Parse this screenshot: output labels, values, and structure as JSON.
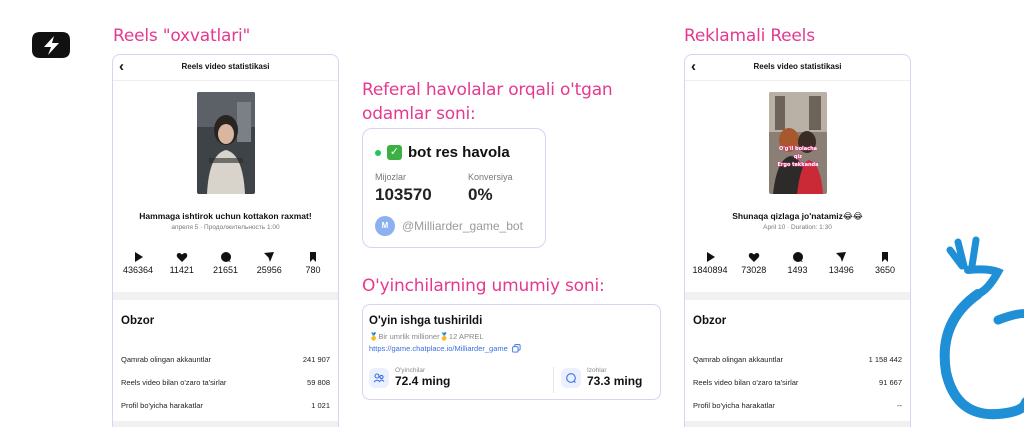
{
  "headings": {
    "left": "Reels \"oxvatlari\"",
    "right": "Reklamali Reels",
    "referral": "Referal havolalar orqali o'tgan odamlar soni:",
    "players": "O'yinchilarning umumiy soni:"
  },
  "phone_left": {
    "back_icon": "chevron-left-icon",
    "title": "Reels video statistikasi",
    "thumb_text": "",
    "caption": "Hammaga ishtirok uchun kottakon raxmat!",
    "meta": "апреля 5 · Продолжительность 1:00",
    "stats": [
      {
        "icon": "play-icon",
        "value": "436364"
      },
      {
        "icon": "heart-icon",
        "value": "11421"
      },
      {
        "icon": "comment-icon",
        "value": "21651"
      },
      {
        "icon": "share-icon",
        "value": "25956"
      },
      {
        "icon": "bookmark-icon",
        "value": "780"
      }
    ],
    "overview_title": "Obzor",
    "rows": [
      {
        "label": "Qamrab olingan akkauntlar",
        "value": "241 907"
      },
      {
        "label": "Reels video bilan o'zaro ta'sirlar",
        "value": "59 808"
      },
      {
        "label": "Profil bo'yicha harakatlar",
        "value": "1 021"
      }
    ]
  },
  "phone_right": {
    "back_icon": "chevron-left-icon",
    "title": "Reels video statistikasi",
    "thumb_text": "O'g'il bolacha qiz Ergo tekkanda",
    "caption": "Shunaqa qizlaga jo'natamiz😂😂",
    "meta": "April 10 · Duration: 1:30",
    "stats": [
      {
        "icon": "play-icon",
        "value": "1840894"
      },
      {
        "icon": "heart-icon",
        "value": "73028"
      },
      {
        "icon": "comment-icon",
        "value": "1493"
      },
      {
        "icon": "share-icon",
        "value": "13496"
      },
      {
        "icon": "bookmark-icon",
        "value": "3650"
      }
    ],
    "overview_title": "Obzor",
    "rows": [
      {
        "label": "Qamrab olingan akkauntlar",
        "value": "1 158 442"
      },
      {
        "label": "Reels video bilan o'zaro ta'sirlar",
        "value": "91 667"
      },
      {
        "label": "Profil bo'yicha harakatlar",
        "value": "--"
      }
    ]
  },
  "referral_card": {
    "check_icon": "check-box-icon",
    "title": "bot res havola",
    "clients_label": "Mijozlar",
    "clients_value": "103570",
    "conversion_label": "Konversiya",
    "conversion_value": "0%",
    "avatar_letter": "M",
    "bot_name": "@Milliarder_game_bot"
  },
  "game_card": {
    "title": "O'yin ishga tushirildi",
    "subtitle": "🥇Bir umrlik millioner🥇12 APREL",
    "link": "https://game.chatplace.io/Milliarder_game",
    "players_label": "O'yinchilar",
    "players_value": "72.4 ming",
    "views_label": "Izohlar",
    "views_value": "73.3 ming"
  },
  "colors": {
    "accent_pink": "#e5398f",
    "card_border": "#d9d2f2",
    "link_blue": "#3b6fe0",
    "blob_blue": "#1f8fd6"
  }
}
